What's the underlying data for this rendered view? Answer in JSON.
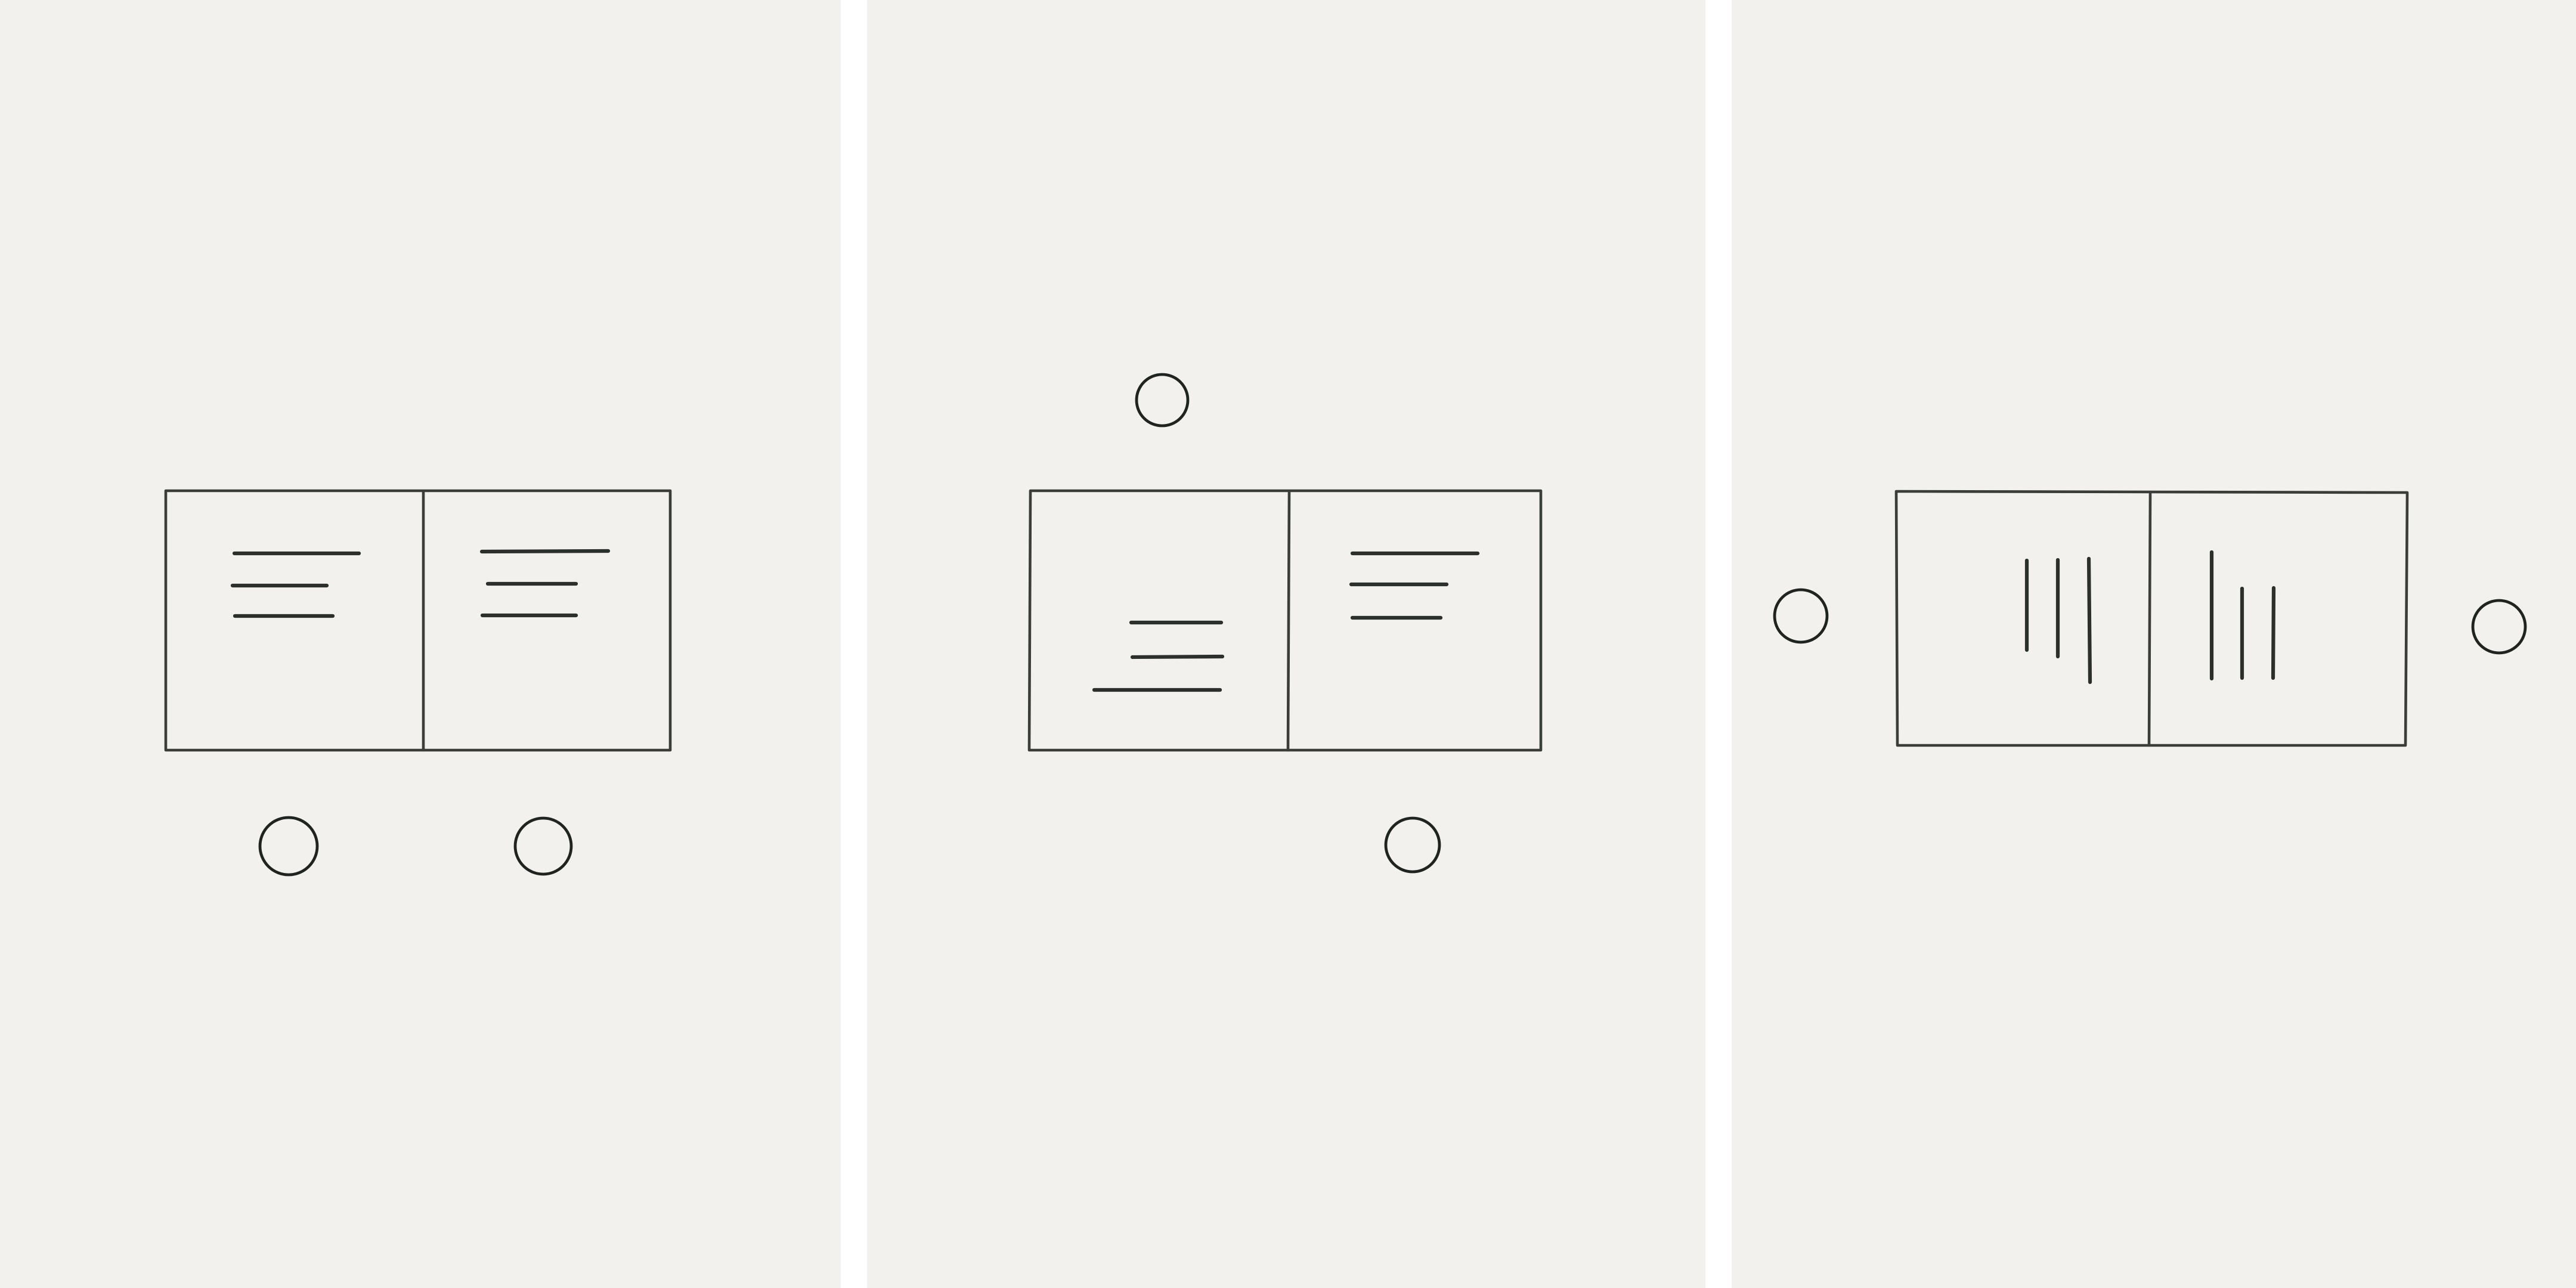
{
  "colors": {
    "paper": "#f2f1ed",
    "gutter": "#ffffff",
    "pencil": "#2e322f"
  },
  "panels": [
    {
      "name": "panel-1",
      "stroke_orientation": "horizontal",
      "circle_count": 2
    },
    {
      "name": "panel-2",
      "stroke_orientation": "horizontal",
      "circle_count": 2
    },
    {
      "name": "panel-3",
      "stroke_orientation": "vertical",
      "circle_count": 2
    }
  ]
}
